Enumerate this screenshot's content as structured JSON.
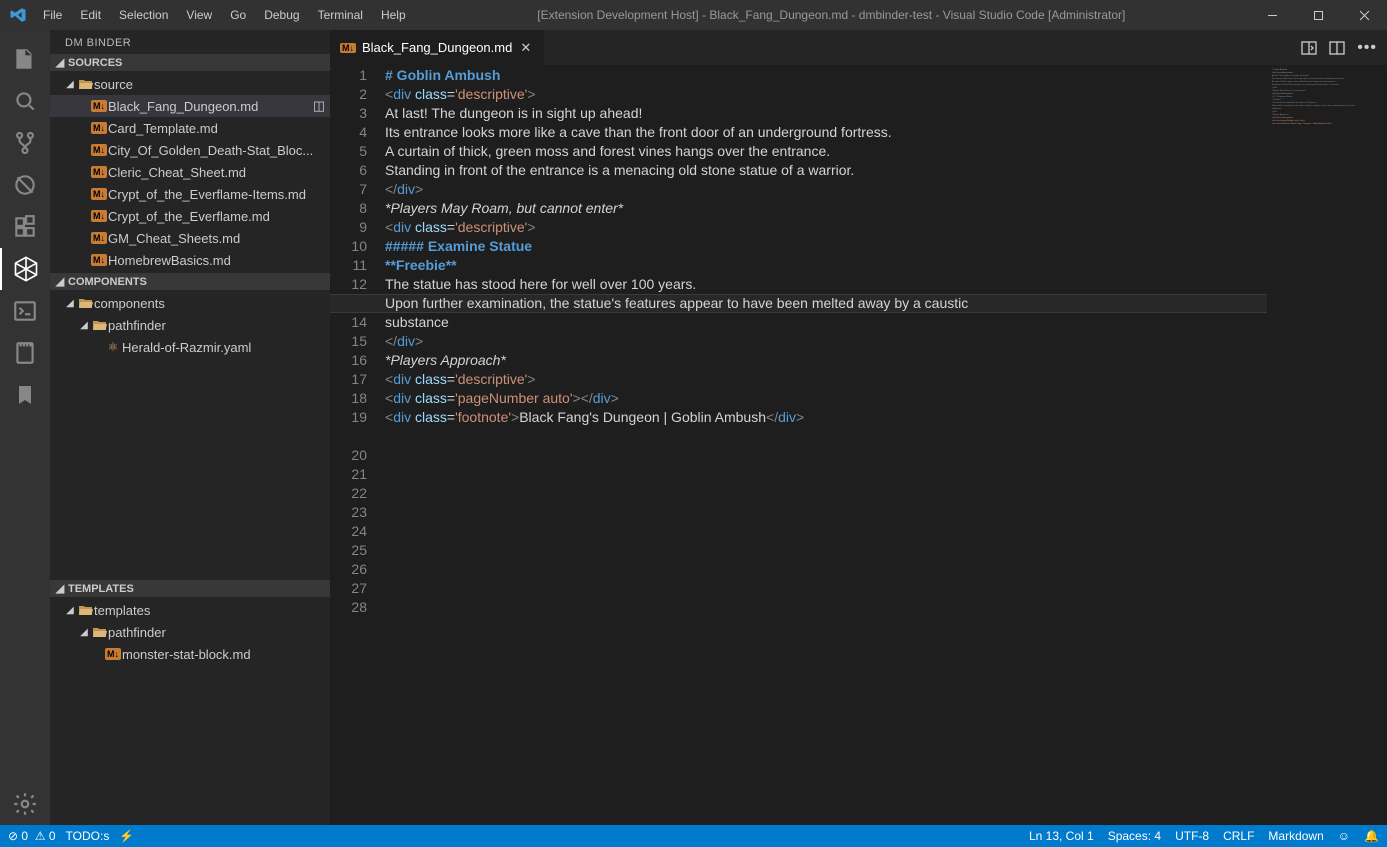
{
  "titlebar": {
    "title": "[Extension Development Host] - Black_Fang_Dungeon.md - dmbinder-test - Visual Studio Code [Administrator]",
    "menus": [
      "File",
      "Edit",
      "Selection",
      "View",
      "Go",
      "Debug",
      "Terminal",
      "Help"
    ]
  },
  "sidebar": {
    "title": "DM BINDER",
    "sections": {
      "sources": {
        "label": "SOURCES",
        "root": "source",
        "files": [
          "Black_Fang_Dungeon.md",
          "Card_Template.md",
          "City_Of_Golden_Death-Stat_Bloc...",
          "Cleric_Cheat_Sheet.md",
          "Crypt_of_the_Everflame-Items.md",
          "Crypt_of_the_Everflame.md",
          "GM_Cheat_Sheets.md",
          "HomebrewBasics.md"
        ]
      },
      "components": {
        "label": "COMPONENTS",
        "root": "components",
        "sub": "pathfinder",
        "file": "Herald-of-Razmir.yaml"
      },
      "templates": {
        "label": "TEMPLATES",
        "root": "templates",
        "sub": "pathfinder",
        "file": "monster-stat-block.md"
      }
    }
  },
  "tab": {
    "file": "Black_Fang_Dungeon.md"
  },
  "editor": {
    "lines": [
      {
        "n": 1,
        "t": [
          [
            "head",
            "# Goblin Ambush"
          ]
        ]
      },
      {
        "n": 2,
        "t": [
          [
            "txt",
            ""
          ]
        ]
      },
      {
        "n": 3,
        "t": [
          [
            "brkt",
            "<"
          ],
          [
            "tag",
            "div"
          ],
          [
            "txt",
            " "
          ],
          [
            "attr",
            "class"
          ],
          [
            "txt",
            "="
          ],
          [
            "str",
            "'descriptive'"
          ],
          [
            "brkt",
            ">"
          ]
        ]
      },
      {
        "n": 4,
        "t": [
          [
            "txt",
            "At last! The dungeon is in sight up ahead!"
          ]
        ]
      },
      {
        "n": 5,
        "t": [
          [
            "txt",
            "Its entrance looks more like a cave than the front door of an underground fortress."
          ]
        ]
      },
      {
        "n": 6,
        "t": [
          [
            "txt",
            "A curtain of thick, green moss and forest vines hangs over the entrance."
          ]
        ]
      },
      {
        "n": 7,
        "t": [
          [
            "txt",
            "Standing in front of the entrance is a menacing old stone statue of a warrior."
          ]
        ]
      },
      {
        "n": 8,
        "t": [
          [
            "brkt",
            "</"
          ],
          [
            "tag",
            "div"
          ],
          [
            "brkt",
            ">"
          ]
        ]
      },
      {
        "n": 9,
        "t": [
          [
            "txt",
            ""
          ]
        ]
      },
      {
        "n": 10,
        "t": [
          [
            "it",
            "*Players May Roam, but cannot enter*"
          ]
        ]
      },
      {
        "n": 11,
        "t": [
          [
            "txt",
            ""
          ]
        ]
      },
      {
        "n": 12,
        "t": [
          [
            "brkt",
            "<"
          ],
          [
            "tag",
            "div"
          ],
          [
            "txt",
            " "
          ],
          [
            "attr",
            "class"
          ],
          [
            "txt",
            "="
          ],
          [
            "str",
            "'descriptive'"
          ],
          [
            "brkt",
            ">"
          ]
        ]
      },
      {
        "n": 13,
        "t": [
          [
            "txt",
            ""
          ]
        ]
      },
      {
        "n": 14,
        "t": [
          [
            "head",
            "##### Examine Statue"
          ]
        ]
      },
      {
        "n": 15,
        "t": [
          [
            "txt",
            ""
          ]
        ]
      },
      {
        "n": 16,
        "t": [
          [
            "bold",
            "**Freebie**"
          ]
        ]
      },
      {
        "n": 17,
        "t": [
          [
            "txt",
            ""
          ]
        ]
      },
      {
        "n": 18,
        "t": [
          [
            "txt",
            "The statue has stood here for well over 100 years."
          ]
        ]
      },
      {
        "n": 19,
        "t": [
          [
            "txt",
            "Upon further examination, the statue's features appear to have been melted away by a caustic "
          ]
        ],
        "wrap": "substance"
      },
      {
        "n": 20,
        "t": [
          [
            "brkt",
            "</"
          ],
          [
            "tag",
            "div"
          ],
          [
            "brkt",
            ">"
          ]
        ]
      },
      {
        "n": 21,
        "t": [
          [
            "txt",
            ""
          ]
        ]
      },
      {
        "n": 22,
        "t": [
          [
            "it",
            "*Players Approach*"
          ]
        ]
      },
      {
        "n": 23,
        "t": [
          [
            "txt",
            ""
          ]
        ]
      },
      {
        "n": 24,
        "t": [
          [
            "brkt",
            "<"
          ],
          [
            "tag",
            "div"
          ],
          [
            "txt",
            " "
          ],
          [
            "attr",
            "class"
          ],
          [
            "txt",
            "="
          ],
          [
            "str",
            "'descriptive'"
          ],
          [
            "brkt",
            ">"
          ]
        ]
      },
      {
        "n": 25,
        "t": [
          [
            "txt",
            ""
          ]
        ]
      },
      {
        "n": 26,
        "t": [
          [
            "txt",
            ""
          ]
        ]
      },
      {
        "n": 27,
        "t": [
          [
            "brkt",
            "<"
          ],
          [
            "tag",
            "div"
          ],
          [
            "txt",
            " "
          ],
          [
            "attr",
            "class"
          ],
          [
            "txt",
            "="
          ],
          [
            "str",
            "'pageNumber auto'"
          ],
          [
            "brkt",
            "></"
          ],
          [
            "tag",
            "div"
          ],
          [
            "brkt",
            ">"
          ]
        ]
      },
      {
        "n": 28,
        "t": [
          [
            "brkt",
            "<"
          ],
          [
            "tag",
            "div"
          ],
          [
            "txt",
            " "
          ],
          [
            "attr",
            "class"
          ],
          [
            "txt",
            "="
          ],
          [
            "str",
            "'footnote'"
          ],
          [
            "brkt",
            ">"
          ],
          [
            "txt",
            "Black Fang's Dungeon | Goblin Ambush"
          ],
          [
            "brkt",
            "</"
          ],
          [
            "tag",
            "div"
          ],
          [
            "brkt",
            ">"
          ]
        ]
      }
    ],
    "currentLine": 13
  },
  "statusbar": {
    "errors": "0",
    "warnings": "0",
    "todo": "TODO:s",
    "pos": "Ln 13, Col 1",
    "spaces": "Spaces: 4",
    "enc": "UTF-8",
    "eol": "CRLF",
    "lang": "Markdown"
  }
}
